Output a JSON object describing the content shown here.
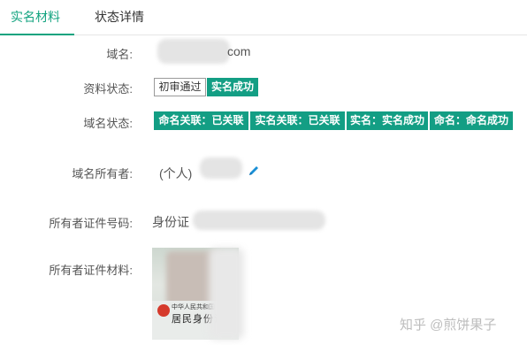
{
  "tabs": [
    {
      "label": "实名材料",
      "active": true
    },
    {
      "label": "状态详情",
      "active": false
    }
  ],
  "rows": {
    "domain": {
      "label": "域名:",
      "suffix": "com"
    },
    "material_status": {
      "label": "资料状态:",
      "badges": [
        "初审通过",
        "实名成功"
      ]
    },
    "domain_status": {
      "label": "域名状态:",
      "badges": [
        "命名关联：已关联",
        "实名关联：已关联",
        "实名：实名成功",
        "命名：命名成功"
      ]
    },
    "owner": {
      "label": "域名所有者:",
      "prefix": "(个人)"
    },
    "id_number": {
      "label": "所有者证件号码:",
      "type": "身份证"
    },
    "id_material": {
      "label": "所有者证件材料:",
      "card_country": "中华人民共和国",
      "card_title": "居民身份证"
    }
  },
  "watermark": "知乎 @煎饼果子",
  "colors": {
    "accent": "#12a37f",
    "badge_green": "#139e84",
    "label_gray": "#555555"
  },
  "icons": {
    "edit": "pencil-icon"
  }
}
